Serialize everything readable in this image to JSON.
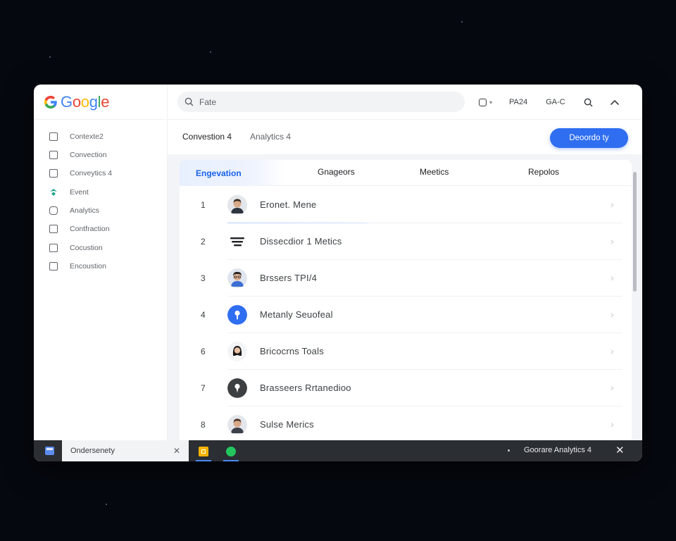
{
  "brand": {
    "logo_text": "Google",
    "logo_letters": [
      "G",
      "o",
      "o",
      "g",
      "l",
      "e"
    ],
    "logo_colors": [
      "#4285F4",
      "#EA4335",
      "#FBBC05",
      "#4285F4",
      "#34A853",
      "#EA4335"
    ]
  },
  "search": {
    "value": "Fate"
  },
  "topbar": {
    "label1": "PA24",
    "label2": "GA-C"
  },
  "sidebar": {
    "items": [
      {
        "label": "Contexte2",
        "icon": "panel-icon"
      },
      {
        "label": "Convection",
        "icon": "plug-icon"
      },
      {
        "label": "Conveytics 4",
        "icon": "panel-icon"
      },
      {
        "label": "Event",
        "icon": "event-icon",
        "accent": "#1fa48a"
      },
      {
        "label": "Analytics",
        "icon": "tag-icon"
      },
      {
        "label": "Contfraction",
        "icon": "edit-icon"
      },
      {
        "label": "Cocustion",
        "icon": "export-icon"
      },
      {
        "label": "Encoustion",
        "icon": "doc-icon"
      }
    ]
  },
  "subheader": {
    "tab1": "Convestion 4",
    "tab2": "Analytics 4",
    "cta_label": "Deoordo ty"
  },
  "columns": [
    "Engevation",
    "Gnageors",
    "Meetics",
    "Repolos"
  ],
  "rows": [
    {
      "num": "1",
      "label": "Eronet. Mene",
      "icon": "avatar-man-icon"
    },
    {
      "num": "2",
      "label": "Dissecdior 1 Metics",
      "icon": "menu-lines-icon"
    },
    {
      "num": "3",
      "label": "Brssers TPI/4",
      "icon": "avatar-glasses-icon"
    },
    {
      "num": "4",
      "label": "Metanly Seuofeal",
      "icon": "mic-icon"
    },
    {
      "num": "6",
      "label": "Bricocrns Toals",
      "icon": "avatar-woman-icon"
    },
    {
      "num": "7",
      "label": "Brasseers Rrtanedioo",
      "icon": "pin-icon"
    },
    {
      "num": "8",
      "label": "Sulse Merics",
      "icon": "avatar-man-icon"
    }
  ],
  "bottombar": {
    "tab_label": "Ondersenety",
    "app_title": "Goorare Analytics 4"
  },
  "colors": {
    "accent": "#2f6ef0",
    "active_tab_text": "#1a63e6",
    "bottombar": "#2b2e33",
    "background": "#05080f"
  }
}
